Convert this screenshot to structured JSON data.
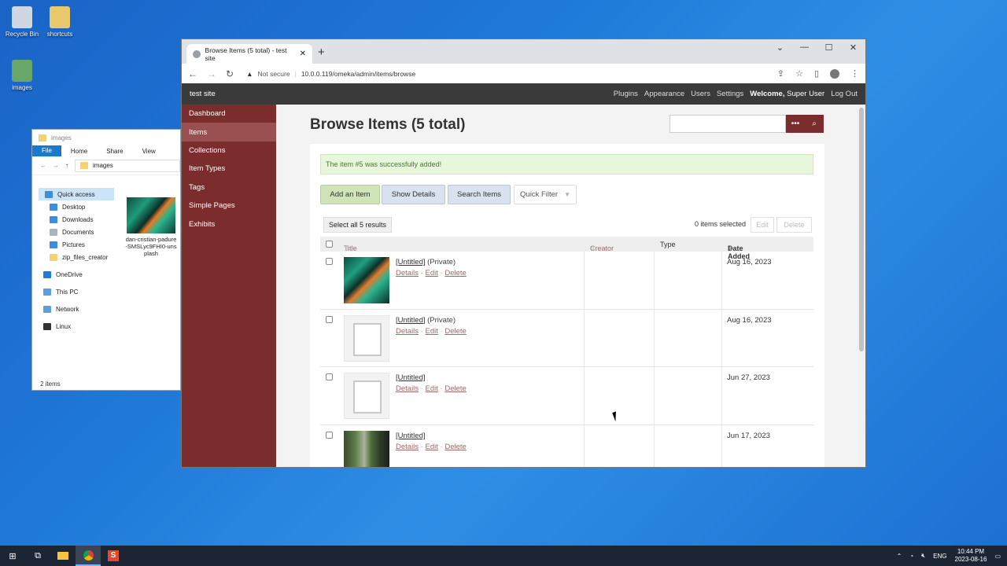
{
  "desktop": {
    "icons": [
      {
        "label": "Recycle Bin"
      },
      {
        "label": "shortcuts"
      },
      {
        "label": "images"
      }
    ]
  },
  "explorer": {
    "title": "images",
    "ribbon": [
      "File",
      "Home",
      "Share",
      "View"
    ],
    "path": "images",
    "nav": {
      "quick_access": "Quick access",
      "pinned": [
        "Desktop",
        "Downloads",
        "Documents",
        "Pictures",
        "zip_files_creator"
      ],
      "onedrive": "OneDrive",
      "this_pc": "This PC",
      "network": "Network",
      "linux": "Linux"
    },
    "file_name": "dan-cristian-padure-SMSLyc9FHI0-unsplash",
    "status": "2 items"
  },
  "browser": {
    "tab_title": "Browse Items (5 total) - test site",
    "not_secure": "Not secure",
    "url": "10.0.0.119/omeka/admin/items/browse"
  },
  "omeka": {
    "site_name": "test site",
    "top_links": [
      "Plugins",
      "Appearance",
      "Users",
      "Settings"
    ],
    "welcome": "Welcome,",
    "user": "Super User",
    "logout": "Log Out",
    "sidebar": [
      "Dashboard",
      "Items",
      "Collections",
      "Item Types",
      "Tags",
      "Simple Pages",
      "Exhibits"
    ],
    "page_title": "Browse Items (5 total)",
    "flash": "The item #5 was successfully added!",
    "buttons": {
      "add": "Add an Item",
      "show_details": "Show Details",
      "search": "Search Items",
      "quick_filter": "Quick Filter"
    },
    "select_all": "Select all 5 results",
    "items_selected": "0 items selected",
    "edit": "Edit",
    "delete": "Delete",
    "columns": {
      "title": "Title",
      "creator": "Creator",
      "type": "Type",
      "date_added": "Date Added"
    },
    "row_links": {
      "details": "Details",
      "edit": "Edit",
      "delete": "Delete"
    },
    "rows": [
      {
        "title": "[Untitled]",
        "private": "(Private)",
        "date": "Aug 16, 2023",
        "thumb": "sea"
      },
      {
        "title": "[Untitled]",
        "private": "(Private)",
        "date": "Aug 16, 2023",
        "thumb": "blank"
      },
      {
        "title": "[Untitled]",
        "private": "",
        "date": "Jun 27, 2023",
        "thumb": "blank"
      },
      {
        "title": "[Untitled]",
        "private": "",
        "date": "Jun 17, 2023",
        "thumb": "tree"
      }
    ]
  },
  "taskbar": {
    "lang": "ENG",
    "time": "10:44 PM",
    "date": "2023-08-16"
  }
}
